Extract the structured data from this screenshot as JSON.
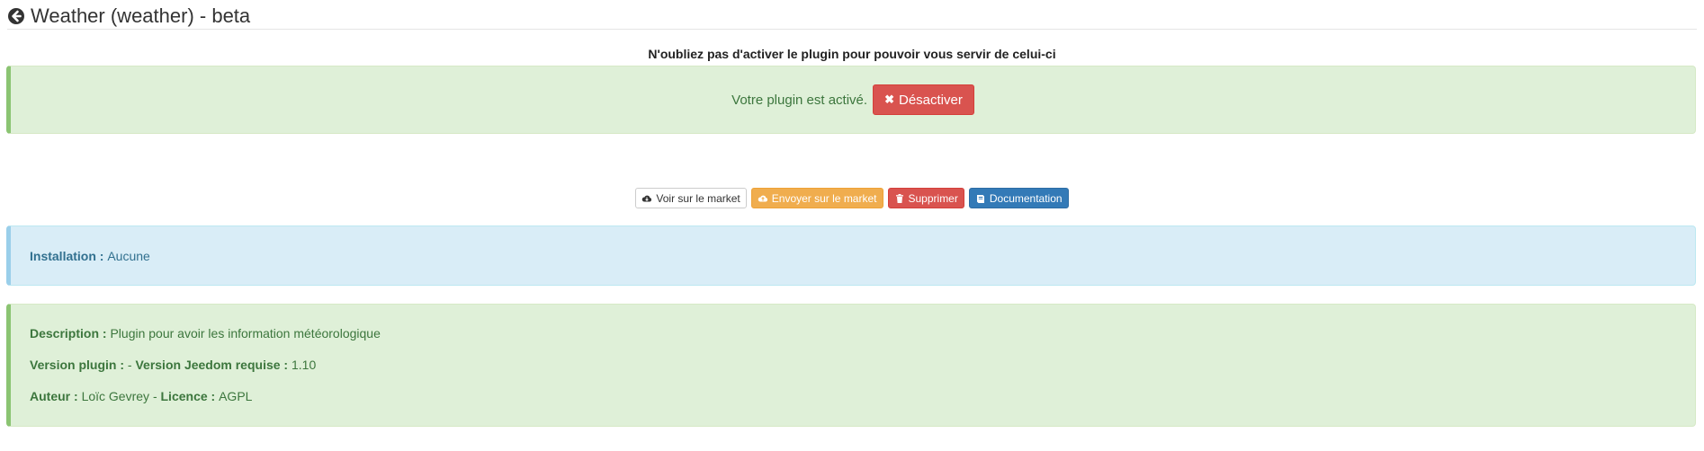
{
  "header": {
    "title": "Weather (weather) - beta",
    "back_icon": "arrow-circle-left-icon"
  },
  "notice": {
    "text": "N'oubliez pas d'activer le plugin pour pouvoir vous servir de celui-ci"
  },
  "status": {
    "text": "Votre plugin est activé.",
    "deactivate_label": "Désactiver"
  },
  "actions": {
    "view_market": "Voir sur le market",
    "send_market": "Envoyer sur le market",
    "delete": "Supprimer",
    "documentation": "Documentation"
  },
  "installation": {
    "label": "Installation :",
    "value": "Aucune"
  },
  "info": {
    "description_label": "Description :",
    "description_value": "Plugin pour avoir les information météorologique",
    "version_label": "Version plugin :",
    "version_sep": "-",
    "jeedom_label": "Version Jeedom requise :",
    "jeedom_value": "1.10",
    "author_label": "Auteur :",
    "author_value": "Loïc Gevrey",
    "author_sep": "-",
    "licence_label": "Licence :",
    "licence_value": "AGPL"
  },
  "colors": {
    "success_bg": "#dff0d8",
    "info_bg": "#d9edf7",
    "danger": "#d9534f",
    "warning": "#f0ad4e",
    "primary": "#337ab7"
  }
}
